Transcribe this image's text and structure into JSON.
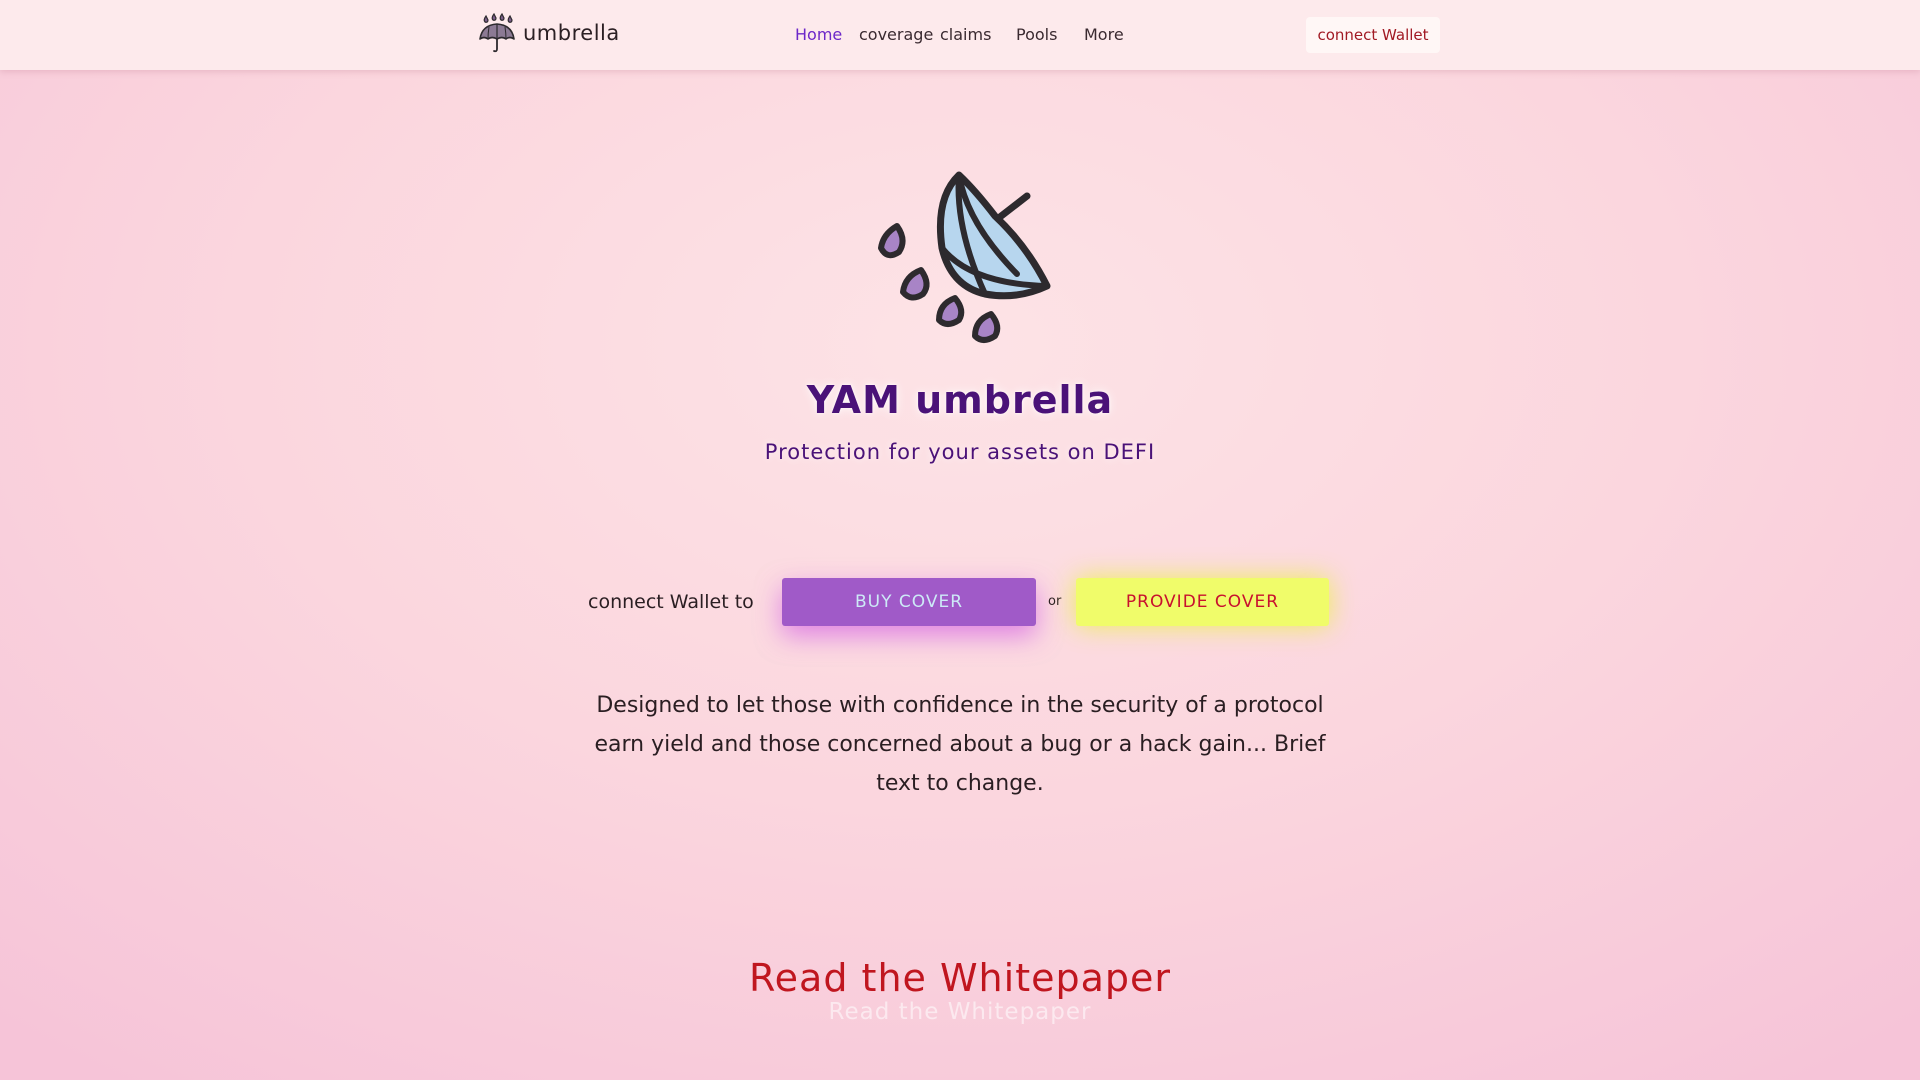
{
  "header": {
    "brand_name": "umbrella",
    "logo_icon": "umbrella-rain-icon",
    "nav": [
      {
        "label": "Home",
        "active": true
      },
      {
        "label": "coverage",
        "active": false
      },
      {
        "label": "claims",
        "active": false
      },
      {
        "label": "Pools",
        "active": false
      },
      {
        "label": "More",
        "active": false
      }
    ],
    "wallet_button": "connect Wallet"
  },
  "hero": {
    "illustration_icon": "umbrella-rain-illustration",
    "title": "YAM umbrella",
    "subtitle": "Protection for your assets on DEFI"
  },
  "cta": {
    "prefix": "connect Wallet to",
    "buy_label": "BUY COVER",
    "or_label": "or",
    "provide_label": "PROVIDE COVER"
  },
  "description": "Designed to let those with confidence in the security of a protocol earn yield and those concerned about a bug or a hack gain... Brief text to change.",
  "whitepaper": {
    "label": "Read the Whitepaper",
    "echo": "Read the Whitepaper"
  },
  "colors": {
    "accent_purple": "#6d28c9",
    "title_purple": "#4a1278",
    "buy_bg": "#a05ac8",
    "provide_bg": "#f0fc6a",
    "link_red": "#c0161f"
  }
}
